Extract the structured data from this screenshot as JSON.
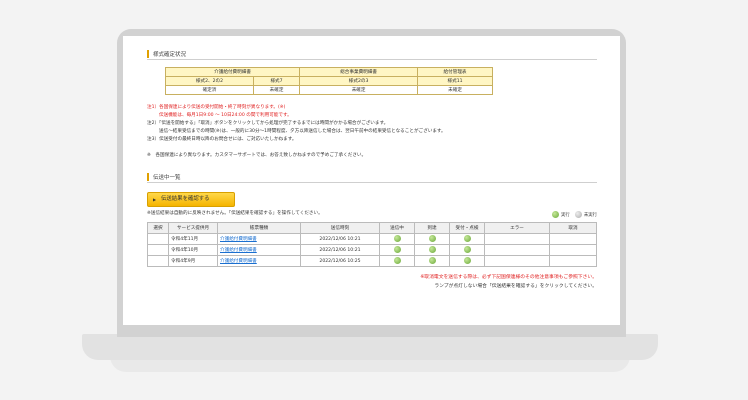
{
  "section1": {
    "title": "様式確定状況"
  },
  "status_table": {
    "group_headers": [
      "介護給付費明細書",
      "総合事業費明細書",
      "給付管理表"
    ],
    "sub_headers": [
      "様式2、2の2",
      "様式7",
      "様式2の3",
      "様式11"
    ],
    "values": [
      "確定済",
      "未確定",
      "未確定",
      "未確定"
    ]
  },
  "notes": {
    "n1": "注1）各国保連により伝送の受付開始・終了時刻が異なります。(※)",
    "n1b": "伝送機能は、毎月1日9:00 ～ 10日24:00 の間で利用可能です。",
    "n2": "注2）「伝送を開始する」「取消」ボタンをクリックしてから処理が完了するまでには時間がかかる場合がございます。",
    "n2b": "送信〜結果受信までの時間(※)は、一般的に30分〜1時間程度、夕方以降送信した場合は、翌日午前中の結果受信となることがございます。",
    "n3": "注3）伝送受付の最終日時以降のお問合せには、ご対応いたしかねます。",
    "n4": "※　各国保連により異なります。カスタマーサポートでは、お答え致しかねますので予めご了承ください。"
  },
  "section2": {
    "title": "伝送中一覧"
  },
  "confirm_button": {
    "arrow": "▶",
    "label": "伝送結果を確認する"
  },
  "confirm_note": "※送信結果は自動的に反映されません。「伝送結果を確認する」を操作してください。",
  "legend": {
    "done": "実行",
    "not_done": "未実行"
  },
  "list": {
    "headers": [
      "選択",
      "サービス提供月",
      "帳票種類",
      "送信時刻",
      "送信中",
      "到達",
      "受付・点検",
      "エラー",
      "取消"
    ],
    "rows": [
      {
        "month": "令和4年11月",
        "form": "介護給付費明細書",
        "time": "2022/12/06 10:21"
      },
      {
        "month": "令和4年10月",
        "form": "介護給付費明細書",
        "time": "2022/12/06 10:21"
      },
      {
        "month": "令和4年9月",
        "form": "介護給付費明細書",
        "time": "2022/12/06 10:25"
      }
    ]
  },
  "footer": {
    "line1": "※取消電文を送信する際は、必ず下記国保連様のその他注意事項もご参照下さい。",
    "line2": "ランプが点灯しない場合「伝送結果を確認する」をクリックしてください。"
  },
  "colors": {
    "accent": "#e0a000",
    "button": "#f5b400",
    "warning": "#e02020",
    "link": "#1a6fd0"
  }
}
